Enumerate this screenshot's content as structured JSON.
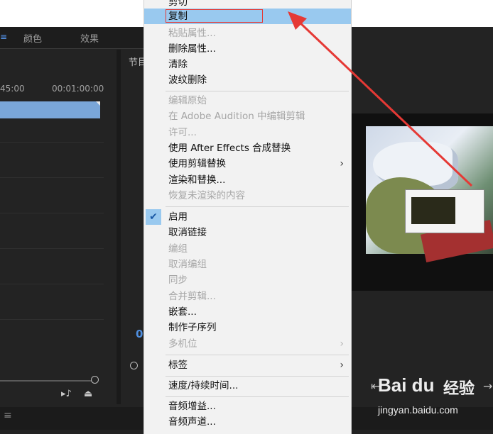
{
  "panels": {
    "tabs": [
      "颜色",
      "效果"
    ],
    "program_label": "节目",
    "ruler": {
      "time_left": "45:00",
      "time_right": "00:01:00:00"
    },
    "timecode_digit": "0"
  },
  "context_menu": {
    "items": [
      {
        "label": "剪切",
        "state": "enabled"
      },
      {
        "label": "复制",
        "state": "enabled",
        "highlighted": true
      },
      {
        "label": "粘贴属性...",
        "state": "disabled"
      },
      {
        "label": "删除属性...",
        "state": "enabled"
      },
      {
        "label": "清除",
        "state": "enabled"
      },
      {
        "label": "波纹删除",
        "state": "enabled"
      },
      {
        "label": "编辑原始",
        "state": "disabled"
      },
      {
        "label": "在 Adobe Audition 中编辑剪辑",
        "state": "disabled"
      },
      {
        "label": "许可...",
        "state": "disabled"
      },
      {
        "label": "使用 After Effects 合成替换",
        "state": "enabled"
      },
      {
        "label": "使用剪辑替换",
        "state": "enabled",
        "submenu": true
      },
      {
        "label": "渲染和替换...",
        "state": "enabled"
      },
      {
        "label": "恢复未渲染的内容",
        "state": "disabled"
      },
      {
        "label": "启用",
        "state": "enabled",
        "checked": true
      },
      {
        "label": "取消链接",
        "state": "enabled"
      },
      {
        "label": "编组",
        "state": "disabled"
      },
      {
        "label": "取消编组",
        "state": "disabled"
      },
      {
        "label": "同步",
        "state": "disabled"
      },
      {
        "label": "合并剪辑...",
        "state": "disabled"
      },
      {
        "label": "嵌套...",
        "state": "enabled"
      },
      {
        "label": "制作子序列",
        "state": "enabled"
      },
      {
        "label": "多机位",
        "state": "disabled",
        "submenu": true
      },
      {
        "label": "标签",
        "state": "enabled",
        "submenu": true
      },
      {
        "label": "速度/持续时间...",
        "state": "enabled"
      },
      {
        "label": "音频增益...",
        "state": "enabled"
      },
      {
        "label": "音频声道...",
        "state": "enabled"
      }
    ]
  },
  "watermark": {
    "logo": "Bai du",
    "jingyan": "经验",
    "url": "jingyan.baidu.com"
  },
  "colors": {
    "highlight": "#99c9ef",
    "annotation": "#e53935",
    "clip": "#7aa6d8",
    "timecode": "#4f8fe0"
  },
  "icons": [
    "check-icon",
    "chevron-right-icon",
    "scrollbar-knob-icon",
    "export-frame-icon",
    "step-back-icon",
    "step-forward-icon",
    "menu-icon"
  ]
}
